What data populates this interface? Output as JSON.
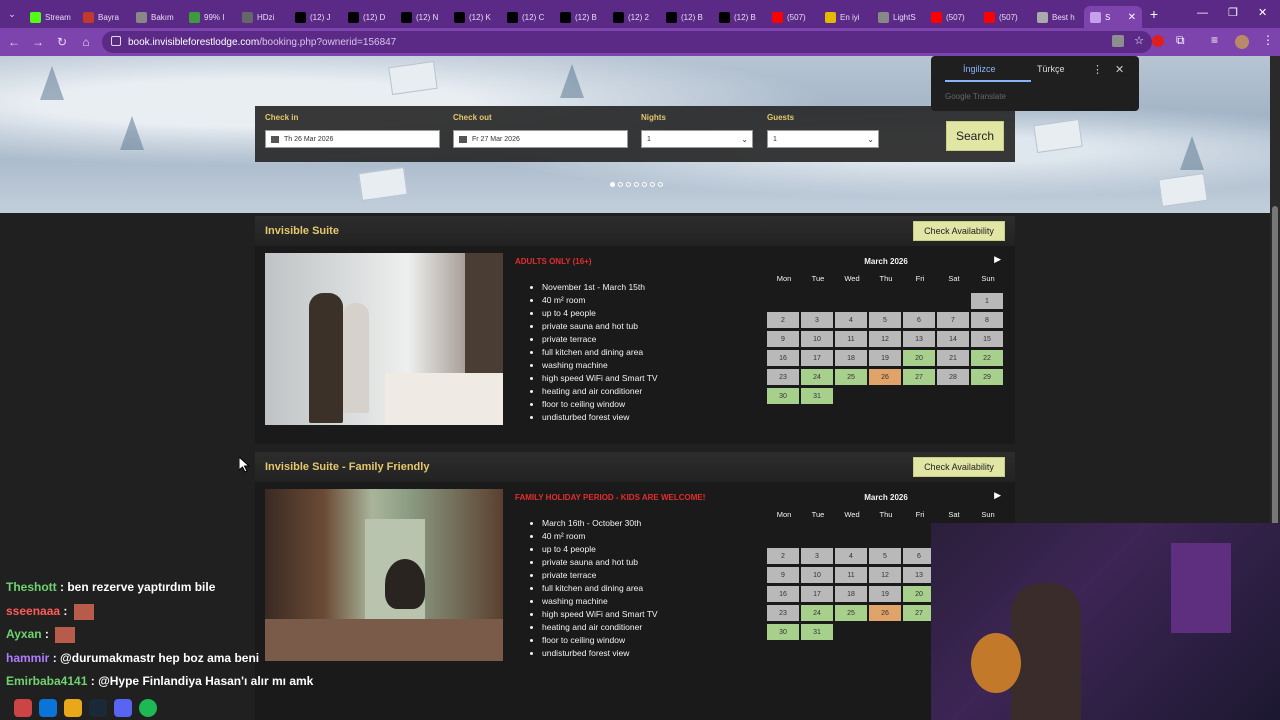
{
  "browser": {
    "tabs": [
      {
        "label": "Stream",
        "color": "#53fc18"
      },
      {
        "label": "Bayra",
        "color": "#c0392b"
      },
      {
        "label": "Bakım",
        "color": "#888888"
      },
      {
        "label": "99% I",
        "color": "#3c9b3c"
      },
      {
        "label": "HDzi",
        "color": "#666666"
      },
      {
        "label": "(12) J",
        "color": "#000000"
      },
      {
        "label": "(12) D",
        "color": "#000000"
      },
      {
        "label": "(12) N",
        "color": "#000000"
      },
      {
        "label": "(12) K",
        "color": "#000000"
      },
      {
        "label": "(12) C",
        "color": "#000000"
      },
      {
        "label": "(12) B",
        "color": "#000000"
      },
      {
        "label": "(12) 2",
        "color": "#000000"
      },
      {
        "label": "(12) B",
        "color": "#000000"
      },
      {
        "label": "(12) B",
        "color": "#000000"
      },
      {
        "label": "(507)",
        "color": "#ff0000"
      },
      {
        "label": "En iyi",
        "color": "#e6b800"
      },
      {
        "label": "LightS",
        "color": "#888888"
      },
      {
        "label": "(507)",
        "color": "#ff0000"
      },
      {
        "label": "(507)",
        "color": "#ff0000"
      },
      {
        "label": "Best h",
        "color": "#aaaaaa"
      }
    ],
    "active_tab": "S",
    "url_host": "book.invisibleforestlodge.com",
    "url_path": "/booking.php?ownerid=156847"
  },
  "translate": {
    "lang1": "İngilizce",
    "lang2": "Türkçe",
    "footer": "Google Translate"
  },
  "search": {
    "checkin_label": "Check in",
    "checkin_value": "Th 26 Mar 2026",
    "checkout_label": "Check out",
    "checkout_value": "Fr 27 Mar 2026",
    "nights_label": "Nights",
    "nights_value": "1",
    "guests_label": "Guests",
    "guests_value": "1",
    "button": "Search"
  },
  "suites": [
    {
      "title": "Invisible Suite",
      "check_button": "Check Availability",
      "notice": "ADULTS ONLY (16+)",
      "features": [
        "November 1st - March 15th",
        "40 m² room",
        "up to 4 people",
        "private sauna and hot tub",
        "private terrace",
        "full kitchen and dining area",
        "washing machine",
        "high speed WiFi and Smart TV",
        "heating and air conditioner",
        "floor to ceiling window",
        "undisturbed forest view"
      ],
      "calendar_month": "March 2026"
    },
    {
      "title": "Invisible Suite - Family Friendly",
      "check_button": "Check Availability",
      "notice": "FAMILY HOLIDAY PERIOD - KIDS ARE WELCOME!",
      "features": [
        "March 16th - October 30th",
        "40 m² room",
        "up to 4 people",
        "private sauna and hot tub",
        "private terrace",
        "full kitchen and dining area",
        "washing machine",
        "high speed WiFi and Smart TV",
        "heating and air conditioner",
        "floor to ceiling window",
        "undisturbed forest view"
      ],
      "calendar_month": "March 2026"
    }
  ],
  "weekdays": [
    "Mon",
    "Tue",
    "Wed",
    "Thu",
    "Fri",
    "Sat",
    "Sun"
  ],
  "chat": [
    {
      "name": "Theshott",
      "msg": "ben rezerve yaptırdım bile",
      "color": "#6ed36e"
    },
    {
      "name": "sseenaaa",
      "msg": "",
      "color": "#ff5b5b"
    },
    {
      "name": "Ayxan",
      "msg": "",
      "color": "#6ed36e"
    },
    {
      "name": "hammir",
      "msg": "@durumakmastr hep boz ama beni",
      "color": "#b07cff"
    },
    {
      "name": "Emirbaba4141",
      "msg": "@Hype Finlandiya Hasan'ı alır mı amk",
      "color": "#6ed36e"
    }
  ]
}
